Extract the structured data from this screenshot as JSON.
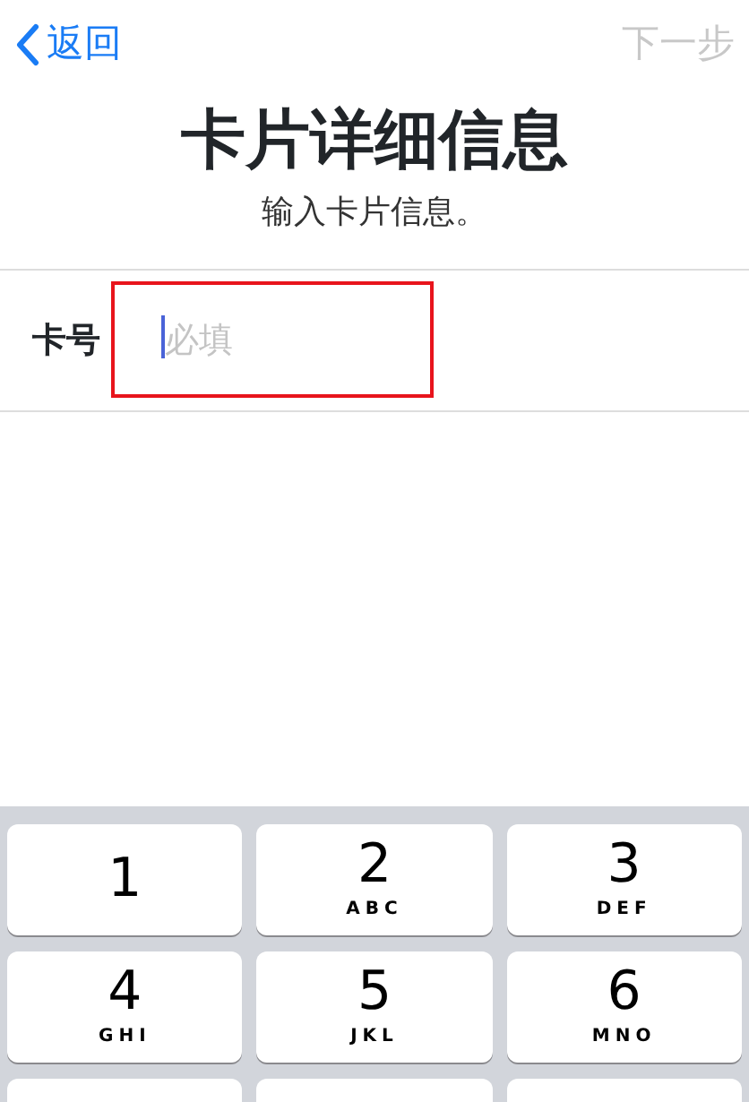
{
  "nav": {
    "back": {
      "label": "返回"
    },
    "next": {
      "label": "下一步",
      "disabled": true
    }
  },
  "header": {
    "title": "卡片详细信息",
    "subtitle": "输入卡片信息。"
  },
  "form": {
    "label": "卡号",
    "placeholder": "必填",
    "focused": true,
    "highlighted": true
  },
  "keypad": {
    "keys": [
      {
        "digit": "1"
      },
      {
        "digit": "2",
        "letters": "ABC"
      },
      {
        "digit": "3",
        "letters": "DEF"
      },
      {
        "digit": "4",
        "letters": "GHI"
      },
      {
        "digit": "5",
        "letters": "JKL"
      },
      {
        "digit": "6",
        "letters": "MNO"
      }
    ]
  }
}
